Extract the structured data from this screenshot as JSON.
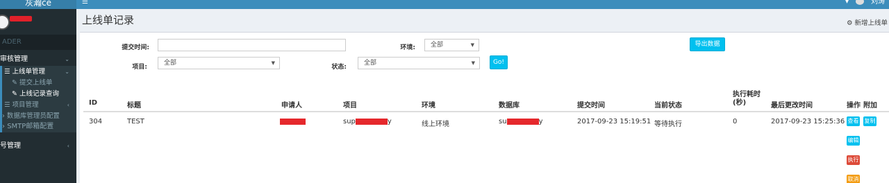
{
  "topbar": {
    "logo": "灰瀚ce",
    "toggle_icon": "bars-icon",
    "user_name": "刘涛"
  },
  "sidebar": {
    "header": "ADER",
    "menu": [
      {
        "label": "审核管理"
      },
      {
        "label": "上线单管理"
      },
      {
        "label": "提交上线单"
      },
      {
        "label": "上线记录查询"
      },
      {
        "label": "项目管理"
      },
      {
        "label": "数据库管理员配置"
      },
      {
        "label": "SMTP邮箱配置"
      },
      {
        "label": "号管理"
      }
    ]
  },
  "page": {
    "title": "上线单记录",
    "new_link": "新增上线单"
  },
  "filters": {
    "submit_time_label": "提交时间:",
    "env_label": "环境:",
    "env_value": "全部",
    "export_button": "导出数据",
    "project_label": "项目:",
    "project_value": "全部",
    "status_label": "状态:",
    "status_value": "全部",
    "go_button": "Go!"
  },
  "table": {
    "headers": [
      "ID",
      "标题",
      "申请人",
      "项目",
      "环境",
      "数据库",
      "提交时间",
      "当前状态",
      "执行耗时(秒)",
      "最后更改时间",
      "操作",
      "附加"
    ],
    "row": {
      "id": "304",
      "title": "TEST",
      "project_start": "sup",
      "project_end": "y",
      "env": "线上环境",
      "db_start": "su",
      "db_end": "y",
      "submit_time": "2017-09-23 15:19:51",
      "status": "等待执行",
      "duration": "0",
      "updated": "2017-09-23 15:25:36"
    },
    "actions": [
      "查看",
      "编辑",
      "执行",
      "取消"
    ],
    "extra": [
      "复制"
    ]
  }
}
